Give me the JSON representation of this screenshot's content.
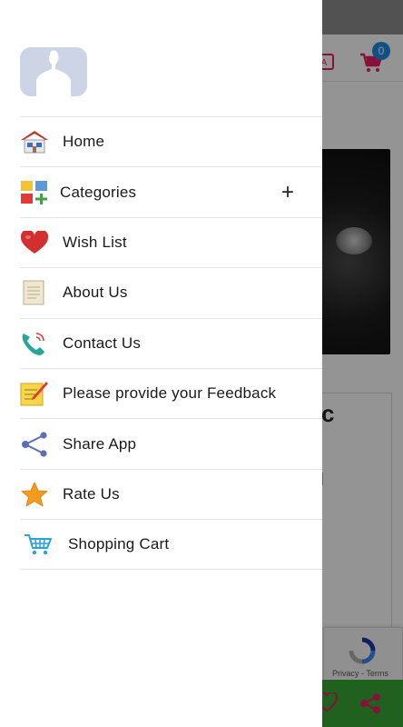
{
  "background": {
    "cart_badge_count": "0",
    "card_title_partial": "c",
    "recaptcha": {
      "privacy": "Privacy",
      "separator": "-",
      "terms": "Terms"
    }
  },
  "drawer": {
    "menu": [
      {
        "label": "Home",
        "icon": "home-icon"
      },
      {
        "label": "Categories",
        "icon": "categories-icon",
        "expand": "+"
      },
      {
        "label": "Wish List",
        "icon": "heart-icon"
      },
      {
        "label": "About Us",
        "icon": "document-icon"
      },
      {
        "label": "Contact Us",
        "icon": "phone-icon"
      },
      {
        "label": "Please provide your Feedback",
        "icon": "notepad-icon"
      },
      {
        "label": "Share App",
        "icon": "share-icon"
      },
      {
        "label": "Rate Us",
        "icon": "star-icon"
      },
      {
        "label": "Shopping Cart",
        "icon": "cart-icon"
      }
    ]
  },
  "colors": {
    "bottom_bar": "#3aa837",
    "badge": "#1e88e5",
    "accent_pink": "#e91e63",
    "heart_red": "#d32f2f",
    "star_orange": "#f29b1d"
  }
}
